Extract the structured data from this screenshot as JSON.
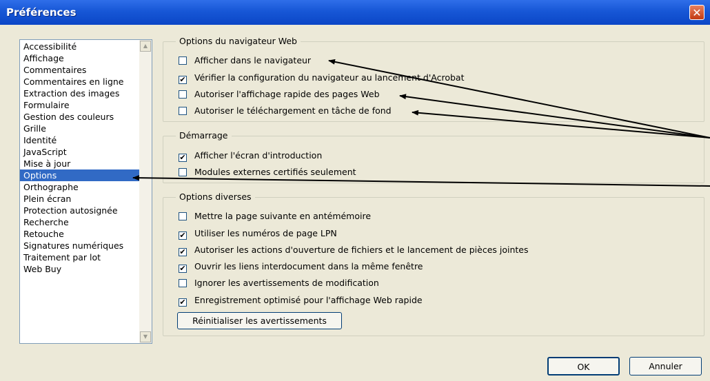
{
  "window": {
    "title": "Préférences",
    "close_glyph": "✕"
  },
  "categories": [
    "Accessibilité",
    "Affichage",
    "Commentaires",
    "Commentaires en ligne",
    "Extraction des images",
    "Formulaire",
    "Gestion des couleurs",
    "Grille",
    "Identité",
    "JavaScript",
    "Mise à jour",
    "Options",
    "Orthographe",
    "Plein écran",
    "Protection autosignée",
    "Recherche",
    "Retouche",
    "Signatures numériques",
    "Traitement par lot",
    "Web Buy"
  ],
  "selected_category": "Options",
  "groups": {
    "browser": {
      "legend": "Options du navigateur Web",
      "options": [
        {
          "label": "Afficher dans le navigateur",
          "checked": false
        },
        {
          "label": "Vérifier la configuration du navigateur au lancement d'Acrobat",
          "checked": true
        },
        {
          "label": "Autoriser l'affichage rapide des pages Web",
          "checked": false
        },
        {
          "label": "Autoriser le téléchargement en tâche de fond",
          "checked": false
        }
      ]
    },
    "startup": {
      "legend": "Démarrage",
      "options": [
        {
          "label": "Afficher l'écran d'introduction",
          "checked": true
        },
        {
          "label": "Modules externes certifiés seulement",
          "checked": false
        }
      ]
    },
    "misc": {
      "legend": "Options diverses",
      "options": [
        {
          "label": "Mettre la page suivante en antémémoire",
          "checked": false
        },
        {
          "label": "Utiliser les numéros de page LPN",
          "checked": true
        },
        {
          "label": "Autoriser les actions d'ouverture de fichiers et le lancement de pièces jointes",
          "checked": true
        },
        {
          "label": "Ouvrir les liens interdocument dans la même fenêtre",
          "checked": true
        },
        {
          "label": "Ignorer les avertissements de modification",
          "checked": false
        },
        {
          "label": "Enregistrement optimisé pour l'affichage Web rapide",
          "checked": true
        }
      ],
      "reset_button": "Réinitialiser les avertissements"
    }
  },
  "buttons": {
    "ok": "OK",
    "cancel": "Annuler"
  },
  "checkmark_glyph": "✔",
  "colors": {
    "titlebar": "#0b46c6",
    "selection": "#316ac5",
    "dialog_bg": "#ece9d8"
  }
}
